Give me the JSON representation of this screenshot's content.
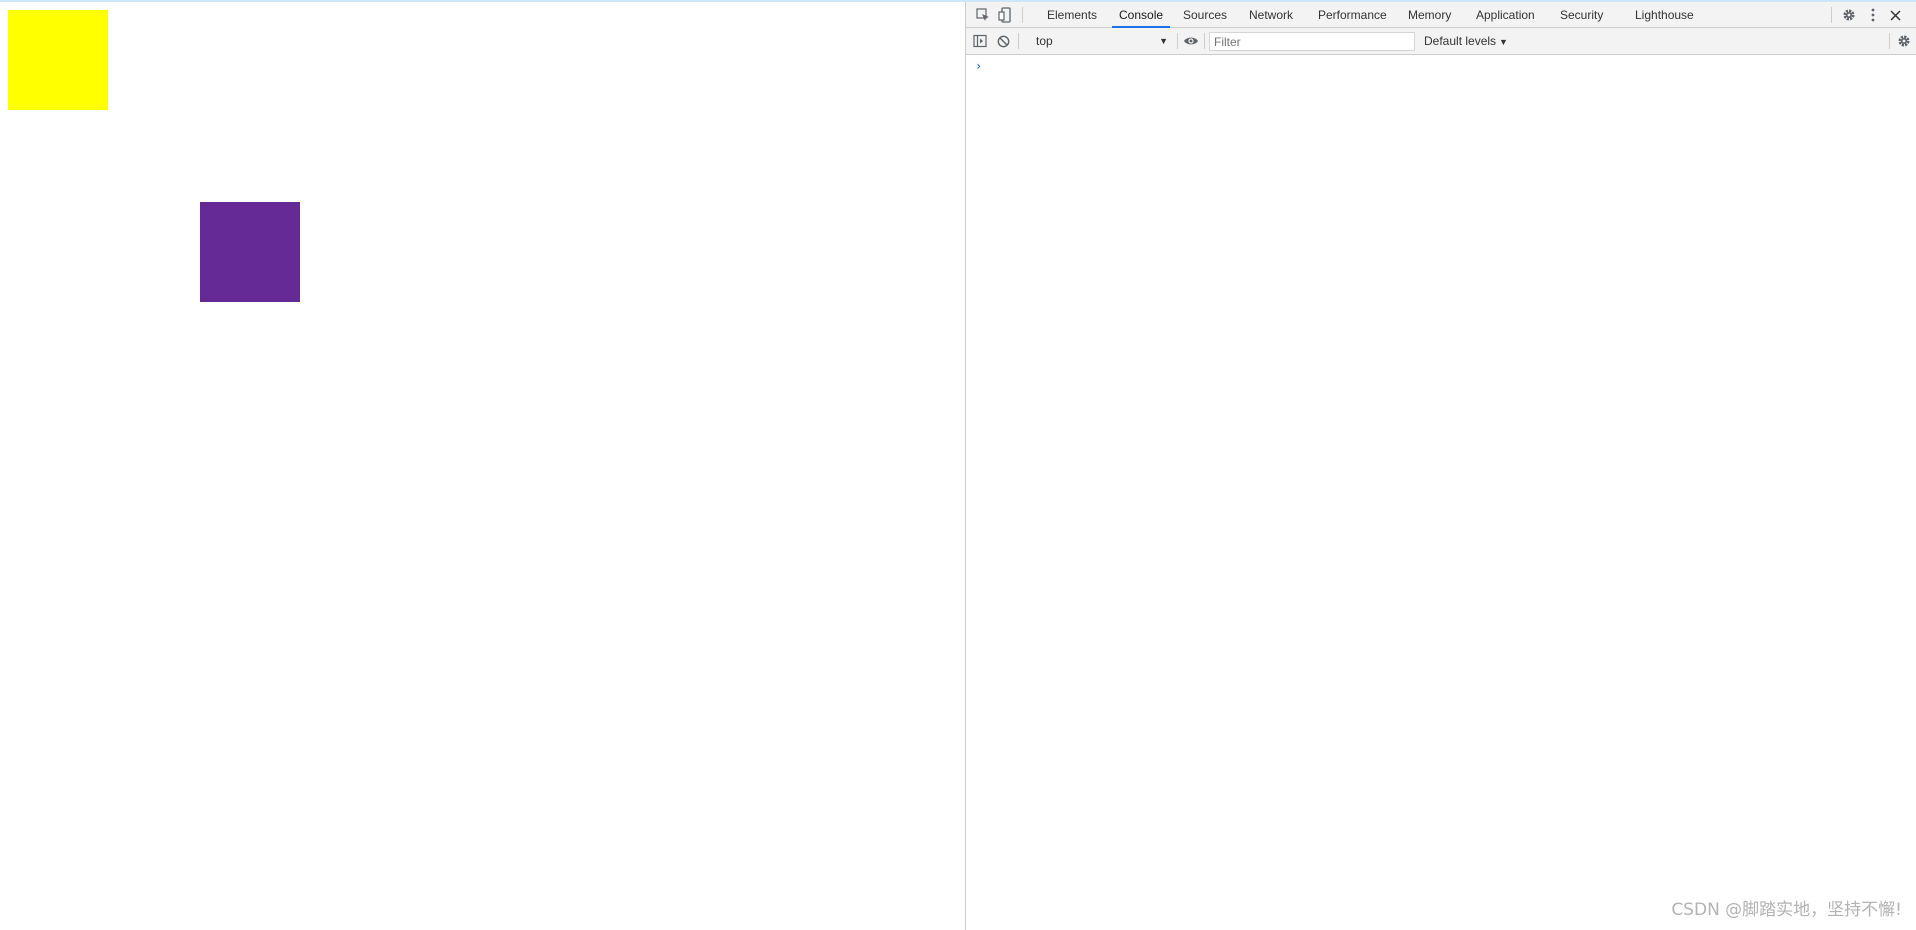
{
  "page": {
    "yellow_color": "#ffff00",
    "purple_color": "#662a96"
  },
  "devtools": {
    "icons": {
      "inspect": "inspect-element-icon",
      "device": "device-toolbar-icon",
      "settings": "gear-icon",
      "more": "more-vertical-icon",
      "close": "close-icon"
    },
    "tabs": [
      {
        "label": "Elements",
        "active": false
      },
      {
        "label": "Console",
        "active": true
      },
      {
        "label": "Sources",
        "active": false
      },
      {
        "label": "Network",
        "active": false
      },
      {
        "label": "Performance",
        "active": false
      },
      {
        "label": "Memory",
        "active": false
      },
      {
        "label": "Application",
        "active": false
      },
      {
        "label": "Security",
        "active": false
      },
      {
        "label": "Lighthouse",
        "active": false
      }
    ],
    "console_toolbar": {
      "context": "top",
      "filter_placeholder": "Filter",
      "filter_value": "",
      "levels": "Default levels"
    },
    "console": {
      "prompt": "›"
    },
    "accent_color": "#1a73e8"
  },
  "watermark": "CSDN @脚踏实地，坚持不懈!"
}
